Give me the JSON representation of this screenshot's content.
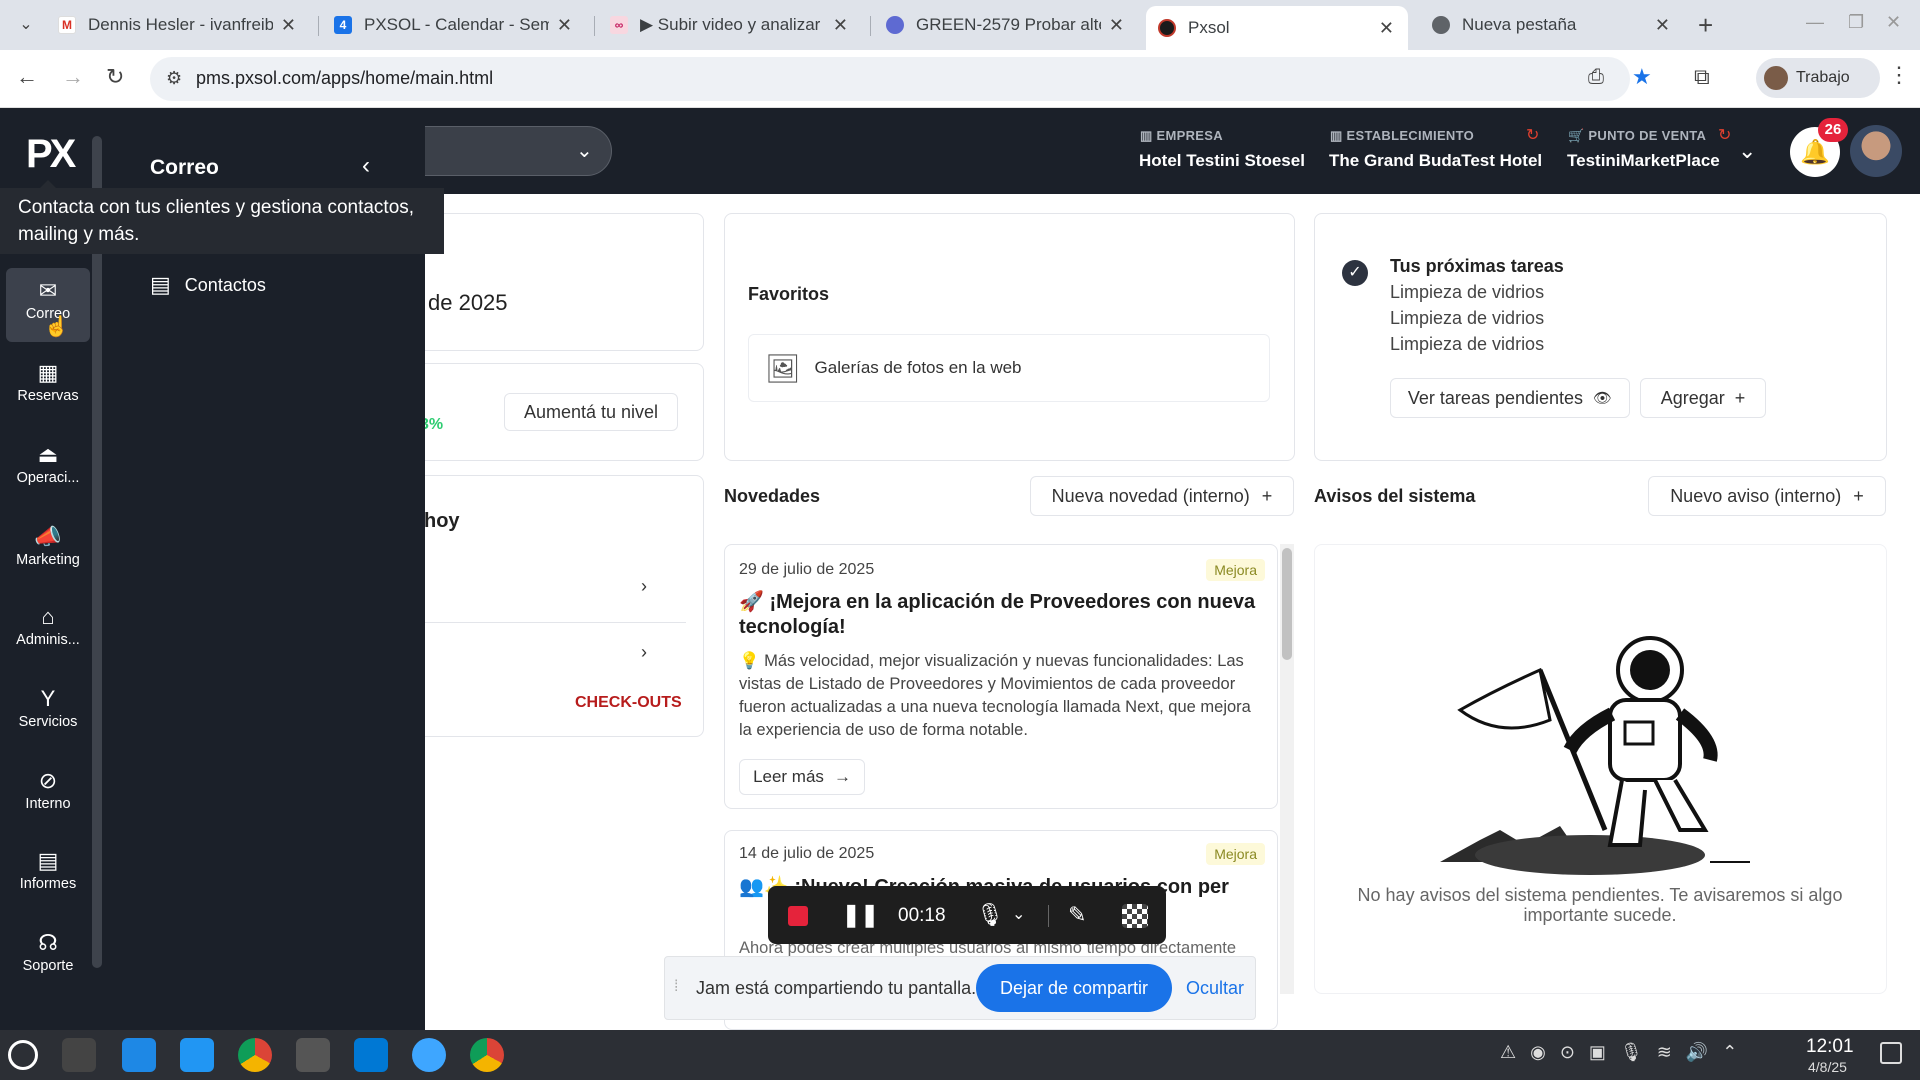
{
  "browser": {
    "tabs": [
      {
        "title": "Dennis Hesler - ivanfreib",
        "icon": "gmail-icon"
      },
      {
        "title": "PXSOL - Calendar - Sem",
        "icon": "calendar-icon"
      },
      {
        "title": "▶ Subir video y analizar",
        "icon": "video-icon"
      },
      {
        "title": "GREEN-2579 Probar alte",
        "icon": "linear-icon"
      },
      {
        "title": "Pxsol",
        "icon": "pxsol-icon"
      },
      {
        "title": "Nueva pestaña",
        "icon": "chrome-icon"
      }
    ],
    "active_tab": "Pxsol",
    "url": "pms.pxsol.com/apps/home/main.html",
    "profile_label": "Trabajo"
  },
  "header": {
    "logo": "PX",
    "empresa_label": "EMPRESA",
    "empresa_value": "Hotel Testini Stoesel",
    "establecimiento_label": "ESTABLECIMIENTO",
    "establecimiento_value": "The Grand BudaTest Hotel",
    "punto_label": "PUNTO DE VENTA",
    "punto_value": "TestiniMarketPlace",
    "notifications_count": "26"
  },
  "sidebar": {
    "drawer_title": "Correo",
    "tooltip": "Contacta con tus clientes y gestiona contactos, mailing y más.",
    "drawer_items": [
      {
        "label": "Contactos",
        "icon": "contacts-icon"
      }
    ],
    "rail": [
      {
        "label": "Correo",
        "icon": "mail-icon"
      },
      {
        "label": "Reservas",
        "icon": "calendar-icon"
      },
      {
        "label": "Operaci...",
        "icon": "bell-service-icon"
      },
      {
        "label": "Marketing",
        "icon": "megaphone-icon"
      },
      {
        "label": "Adminis...",
        "icon": "bank-icon"
      },
      {
        "label": "Servicios",
        "icon": "cocktail-icon"
      },
      {
        "label": "Interno",
        "icon": "block-icon"
      },
      {
        "label": "Informes",
        "icon": "report-icon"
      },
      {
        "label": "Soporte",
        "icon": "support-icon"
      }
    ]
  },
  "left_cards": {
    "date_fragment": "de 2025",
    "level_button": "Aumentá tu nivel",
    "percent_fragment": "3%",
    "today_fragment": "hoy",
    "checkouts": "CHECK-OUTS"
  },
  "favoritos": {
    "title": "Favoritos",
    "items": [
      {
        "label": "Galerías de fotos en la web",
        "icon": "gallery-icon"
      }
    ]
  },
  "tareas": {
    "title": "Tus próximas tareas",
    "items": [
      "Limpieza de vidrios",
      "Limpieza de vidrios",
      "Limpieza de vidrios"
    ],
    "ver_button": "Ver tareas pendientes",
    "agregar_button": "Agregar"
  },
  "novedades": {
    "title": "Novedades",
    "new_button": "Nueva novedad (interno)",
    "items": [
      {
        "date": "29 de julio de 2025",
        "tag": "Mejora",
        "title": "🚀 ¡Mejora en la aplicación de Proveedores con nueva tecnología!",
        "body": "💡 Más velocidad, mejor visualización y nuevas funcionalidades: Las vistas de Listado de Proveedores y Movimientos de cada proveedor fueron actualizadas a una nueva tecnología llamada Next, que mejora la experiencia de uso de forma notable.",
        "read_more": "Leer más"
      },
      {
        "date": "14 de julio de 2025",
        "tag": "Mejora",
        "title": "👥✨ ¡Nuevo! Creación masiva de usuarios con per",
        "body": "Ahora podés crear múltiples usuarios al mismo tiempo directamente desde la aplicación de usuarios."
      }
    ]
  },
  "avisos": {
    "title": "Avisos del sistema",
    "new_button": "Nuevo aviso (interno)",
    "empty_text": "No hay avisos del sistema pendientes. Te avisaremos si algo importante sucede."
  },
  "recording": {
    "time": "00:18",
    "share_text": "Jam está compartiendo tu pantalla.",
    "stop_button": "Dejar de compartir",
    "hide_button": "Ocultar"
  },
  "taskbar": {
    "time": "12:01",
    "date": "4/8/25"
  }
}
